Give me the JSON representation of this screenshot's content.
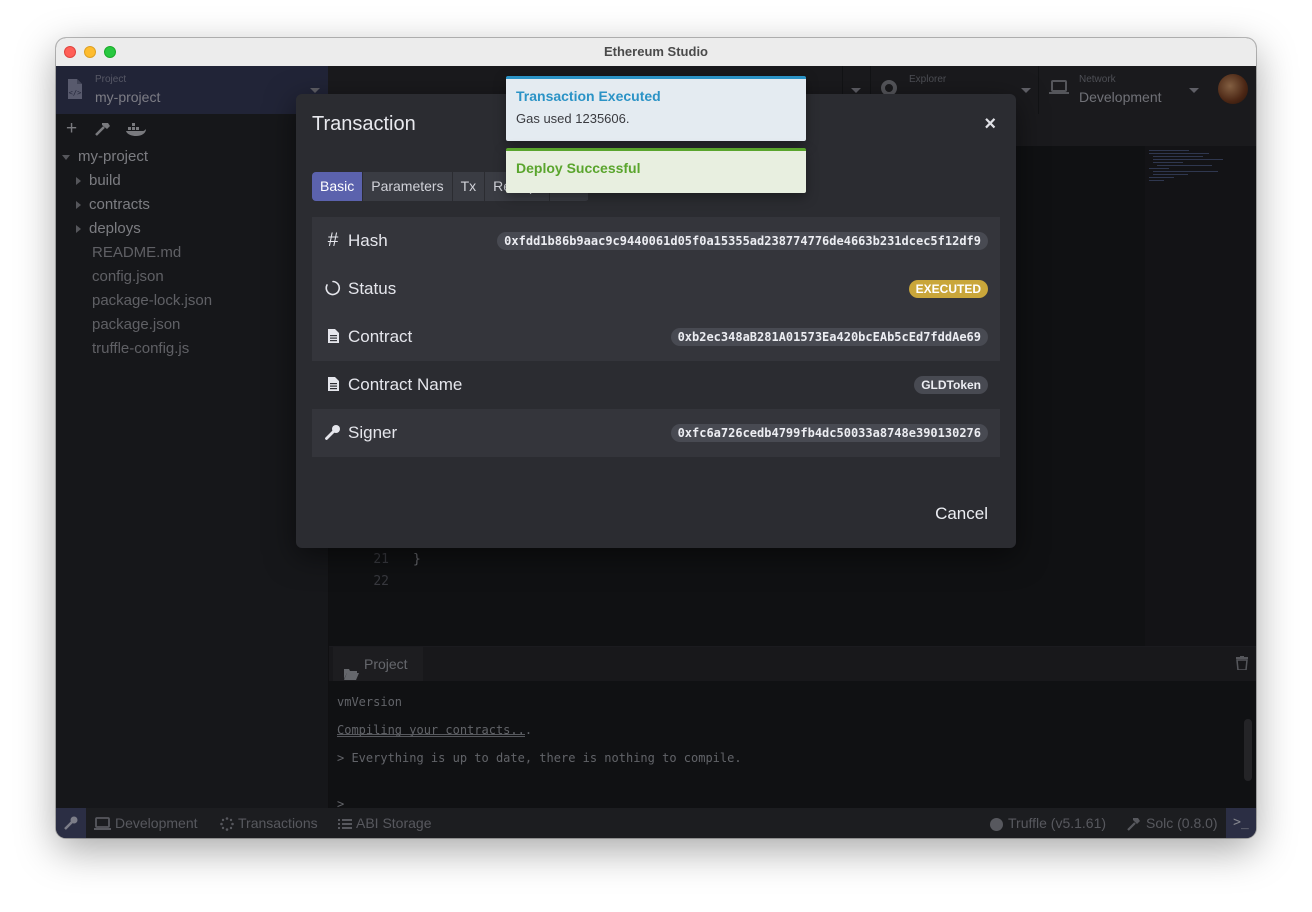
{
  "window": {
    "title": "Ethereum Studio"
  },
  "topbar": {
    "project_label": "Project",
    "project_name": "my-project",
    "explorer_label": "Explorer",
    "network_label": "Network",
    "network_value": "Development"
  },
  "sidebar": {
    "root": "my-project",
    "folders": [
      "build",
      "contracts",
      "deploys"
    ],
    "files": [
      "README.md",
      "config.json",
      "package-lock.json",
      "package.json",
      "truffle-config.js"
    ]
  },
  "editor": {
    "lines": [
      {
        "no": "21",
        "text": "}"
      },
      {
        "no": "22",
        "text": ""
      }
    ]
  },
  "panel": {
    "tab_label": "Project",
    "lines": [
      "vmVersion",
      "Compiling your contracts...",
      "> Everything is up to date, there is nothing to compile."
    ],
    "prompt": ">"
  },
  "statusbar": {
    "network": "Development",
    "transactions": "Transactions",
    "abi_storage": "ABI Storage",
    "truffle": "Truffle (v5.1.61)",
    "solc": "Solc (0.8.0)"
  },
  "modal": {
    "title": "Transaction",
    "close": "×",
    "tabs": [
      "Basic",
      "Parameters",
      "Tx",
      "Receipt",
      "ABI"
    ],
    "rows": {
      "hash": {
        "label": "Hash",
        "value": "0xfdd1b86b9aac9c9440061d05f0a15355ad238774776de4663b231dcec5f12df9"
      },
      "status": {
        "label": "Status",
        "value": "EXECUTED"
      },
      "contract": {
        "label": "Contract",
        "value": "0xb2ec348aB281A01573Ea420bcEAb5cEd7fddAe69"
      },
      "contract_name": {
        "label": "Contract Name",
        "value": "GLDToken"
      },
      "signer": {
        "label": "Signer",
        "value": "0xfc6a726cedb4799fb4dc50033a8748e390130276"
      }
    },
    "cancel": "Cancel"
  },
  "toasts": {
    "executed": {
      "title": "Transaction Executed",
      "body": "Gas used 1235606.",
      "color": "#2b93c6"
    },
    "deploy": {
      "title": "Deploy Successful",
      "color": "#5aa52d"
    }
  },
  "colors": {
    "accent": "#5b62ad",
    "badge": "#c9a63a"
  }
}
